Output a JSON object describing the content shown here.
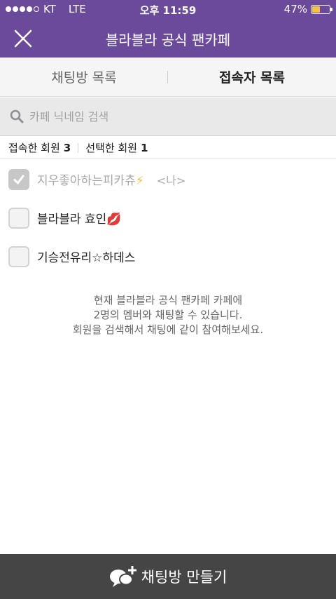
{
  "status_bar": {
    "carrier": "KT",
    "network": "LTE",
    "time": "오후 11:59",
    "battery_percent": "47%",
    "battery_level": 0.47,
    "signal_dots_filled": 4,
    "signal_dots_total": 5
  },
  "header": {
    "title": "블라블라 공식 팬카페",
    "close_icon": "close-icon"
  },
  "tabs": [
    {
      "label": "채팅방 목록",
      "active": false
    },
    {
      "label": "접속자 목록",
      "active": true
    }
  ],
  "search": {
    "placeholder": "카페 닉네임 검색",
    "value": "",
    "icon": "search-icon"
  },
  "counts": {
    "connected_label": "접속한 회원",
    "connected_count": "3",
    "selected_label": "선택한 회원",
    "selected_count": "1"
  },
  "members": [
    {
      "name": "지우좋아하는피카츄",
      "emoji": "⚡",
      "me_tag": "<나>",
      "checked": true
    },
    {
      "name": "블라블라 효인",
      "emoji": "💋",
      "me_tag": "",
      "checked": false
    },
    {
      "name": "기승전유리☆하데스",
      "emoji": "",
      "me_tag": "",
      "checked": false
    }
  ],
  "info_lines": [
    "현재 블라블라 공식 팬카페 카페에",
    "2명의 멤버와 채팅할 수 있습니다.",
    "회원을 검색해서 채팅에 같이 참여해보세요."
  ],
  "bottom_button": {
    "label": "채팅방 만들기",
    "icon": "chat-add-icon"
  },
  "colors": {
    "header_bg": "#6b4a9b",
    "battery": "#f6c23e",
    "bottom_bar": "#454545"
  }
}
